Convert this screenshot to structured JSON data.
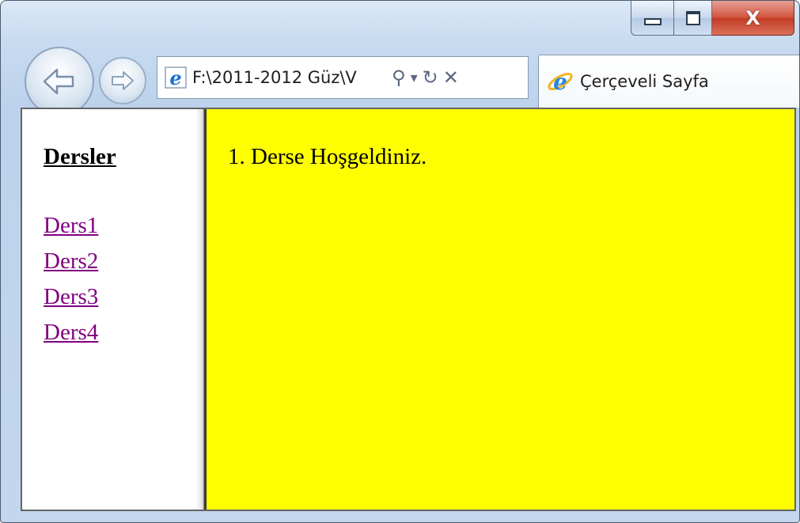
{
  "browser": {
    "address_url": "F:\\2011-2012 Güz\\V",
    "tab_title": "Çerçeveli Sayfa",
    "window_controls": {
      "minimize_icon": "minimize-icon",
      "maximize_icon": "maximize-icon",
      "close_icon": "close-icon",
      "close_glyph": "X"
    },
    "address_buttons": {
      "search_glyph": "⚲",
      "dropdown_glyph": "▾",
      "refresh_glyph": "↻",
      "stop_glyph": "✕"
    }
  },
  "left_frame": {
    "title": "Dersler",
    "links": [
      "Ders1",
      "Ders2",
      "Ders3",
      "Ders4"
    ]
  },
  "right_frame": {
    "message": "1. Derse Hoşgeldiniz."
  },
  "colors": {
    "right_frame_bg": "#ffff00",
    "link_color": "#800080"
  }
}
